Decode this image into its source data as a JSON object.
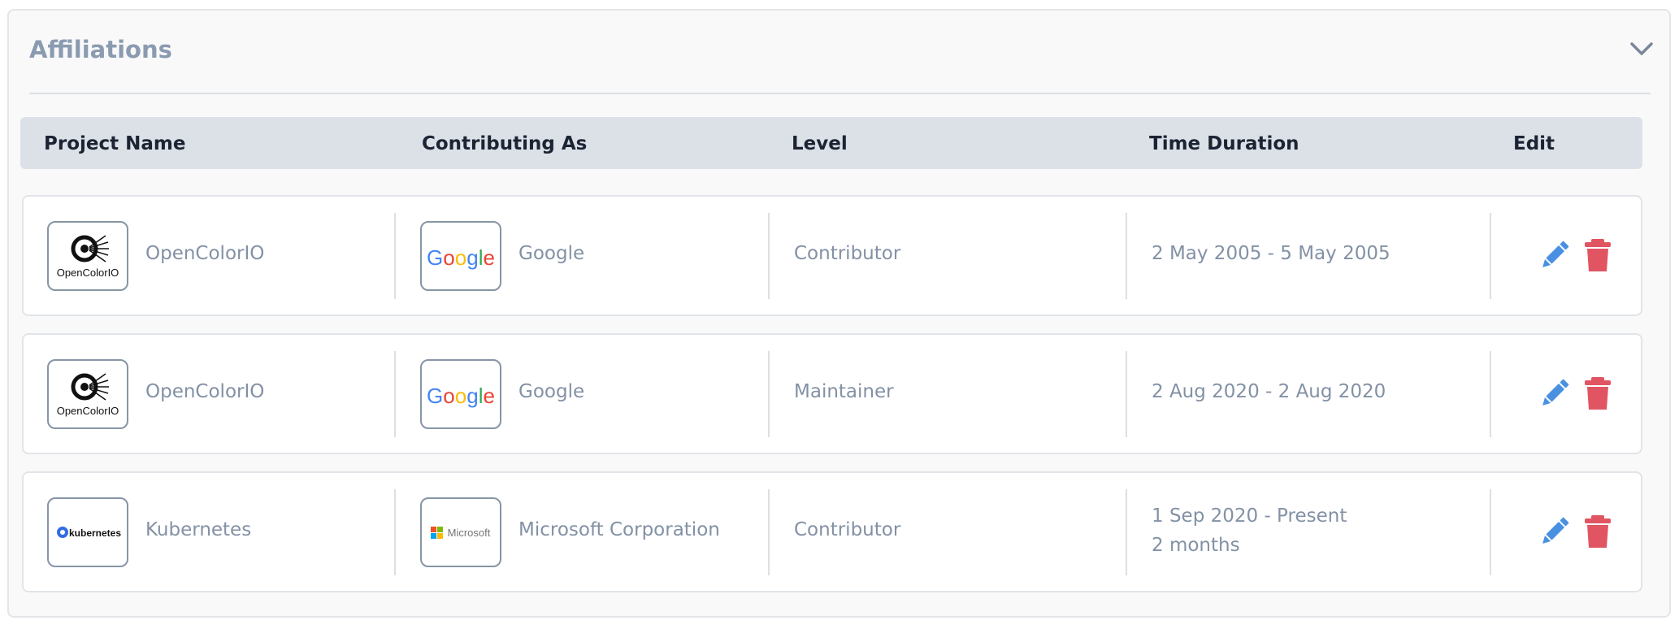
{
  "panel": {
    "title": "Affiliations",
    "collapse_icon": "chevron-down-icon"
  },
  "table": {
    "headers": [
      "Project Name",
      "Contributing As",
      "Level",
      "Time Duration",
      "Edit"
    ],
    "rows": [
      {
        "project": "OpenColorIO",
        "project_logo": "opencolorio-logo",
        "organization": "Google",
        "organization_logo": "google-logo",
        "level": "Contributor",
        "duration": "2 May 2005 - 5 May 2005",
        "duration_extra": ""
      },
      {
        "project": "OpenColorIO",
        "project_logo": "opencolorio-logo",
        "organization": "Google",
        "organization_logo": "google-logo",
        "level": "Maintainer",
        "duration": "2 Aug 2020 - 2 Aug 2020",
        "duration_extra": ""
      },
      {
        "project": "Kubernetes",
        "project_logo": "kubernetes-logo",
        "organization": "Microsoft Corporation",
        "organization_logo": "microsoft-logo",
        "level": "Contributor",
        "duration": "1 Sep 2020 - Present",
        "duration_extra": "2 months"
      }
    ]
  },
  "logo_text": {
    "opencolorio": "OpenColorIO",
    "google": "Google",
    "kubernetes": "kubernetes",
    "microsoft": "Microsoft"
  },
  "colors": {
    "edit_icon": "#4a90e2",
    "delete_icon": "#e15563",
    "header_bg": "#dce1e7",
    "title": "#8a9bb1"
  }
}
